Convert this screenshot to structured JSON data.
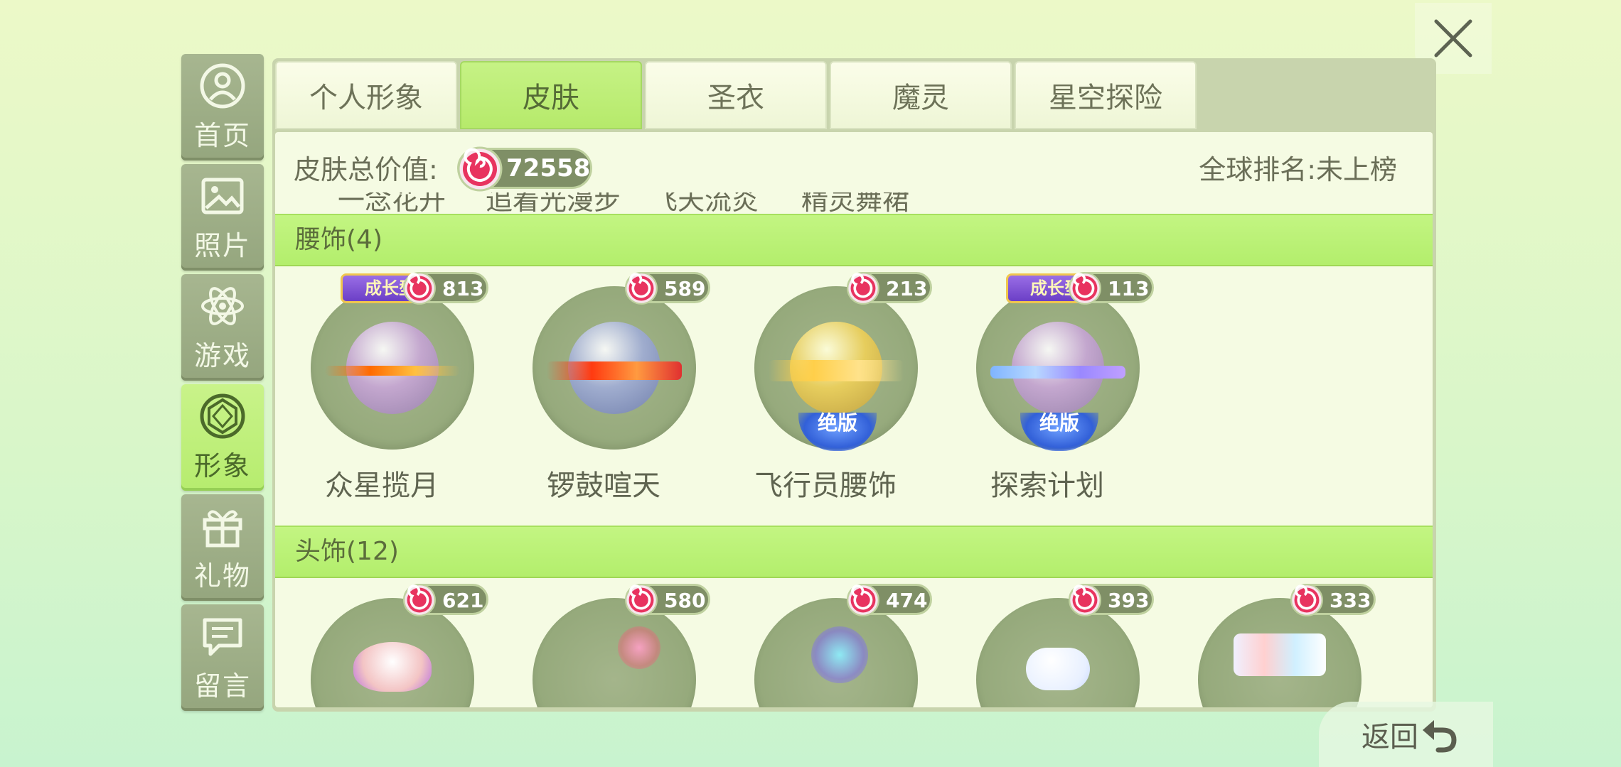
{
  "sidebar": {
    "items": [
      {
        "label": "首页",
        "icon": "user-icon",
        "active": false
      },
      {
        "label": "照片",
        "icon": "image-icon",
        "active": false
      },
      {
        "label": "游戏",
        "icon": "atom-icon",
        "active": false
      },
      {
        "label": "形象",
        "icon": "diamond-icon",
        "active": true
      },
      {
        "label": "礼物",
        "icon": "gift-icon",
        "active": false
      },
      {
        "label": "留言",
        "icon": "message-icon",
        "active": false
      }
    ]
  },
  "tabs": [
    {
      "label": "个人形象",
      "active": false
    },
    {
      "label": "皮肤",
      "active": true
    },
    {
      "label": "圣衣",
      "active": false
    },
    {
      "label": "魔灵",
      "active": false
    },
    {
      "label": "星空探险",
      "active": false
    }
  ],
  "summary": {
    "label": "皮肤总价值:",
    "value": "72558",
    "rank": "全球排名:未上榜"
  },
  "partial_row": [
    "一念花开",
    "追着光漫步",
    "飞天流炎",
    "精灵舞裙"
  ],
  "sections": [
    {
      "title": "腰饰(4)",
      "items": [
        {
          "name": "众星揽月",
          "price": "813",
          "badge_top": "成长型",
          "badge_bottom": ""
        },
        {
          "name": "锣鼓喧天",
          "price": "589",
          "badge_top": "",
          "badge_bottom": ""
        },
        {
          "name": "飞行员腰饰",
          "price": "213",
          "badge_top": "",
          "badge_bottom": "绝版"
        },
        {
          "name": "探索计划",
          "price": "113",
          "badge_top": "成长型",
          "badge_bottom": "绝版"
        }
      ]
    },
    {
      "title": "头饰(12)",
      "items": [
        {
          "name": "",
          "price": "621"
        },
        {
          "name": "",
          "price": "580"
        },
        {
          "name": "",
          "price": "474"
        },
        {
          "name": "",
          "price": "393"
        },
        {
          "name": "",
          "price": "333"
        }
      ]
    }
  ],
  "back": {
    "label": "返回"
  },
  "colors": {
    "accent_green": "#b6ec6e",
    "sidebar": "#9aab82",
    "pill": "#7f8f66"
  }
}
